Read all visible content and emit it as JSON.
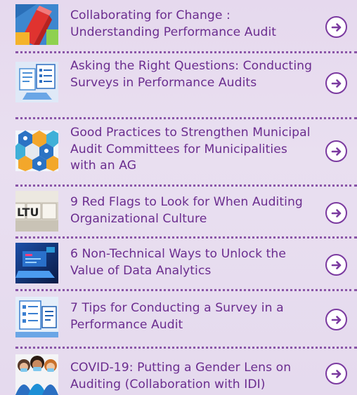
{
  "items": [
    {
      "title": "Collaborating for Change : Understanding Performance Audit",
      "thumb_icon": "books-thumbnail"
    },
    {
      "title": "Asking the Right Questions: Conducting Surveys in Performance Audits",
      "thumb_icon": "survey-thumbnail"
    },
    {
      "title": "Good Practices to Strengthen Municipal Audit Committees for Municipalities with an AG",
      "thumb_icon": "hexagon-people-thumbnail"
    },
    {
      "title": "9 Red Flags to Look for When Auditing Organizational Culture",
      "thumb_icon": "letter-tiles-thumbnail",
      "thumb_text": "LTU"
    },
    {
      "title": "6 Non-Technical Ways to Unlock the Value of Data Analytics",
      "thumb_icon": "data-laptop-thumbnail"
    },
    {
      "title": "7 Tips for Conducting a Survey in a Performance Audit",
      "thumb_icon": "survey-forms-thumbnail"
    },
    {
      "title": "COVID-19: Putting a Gender Lens on Auditing (Collaboration with IDI)",
      "thumb_icon": "masked-women-thumbnail"
    }
  ],
  "colors": {
    "title": "#6b2d8f",
    "accent": "#7b3aa0",
    "background": "#e8dcef"
  }
}
